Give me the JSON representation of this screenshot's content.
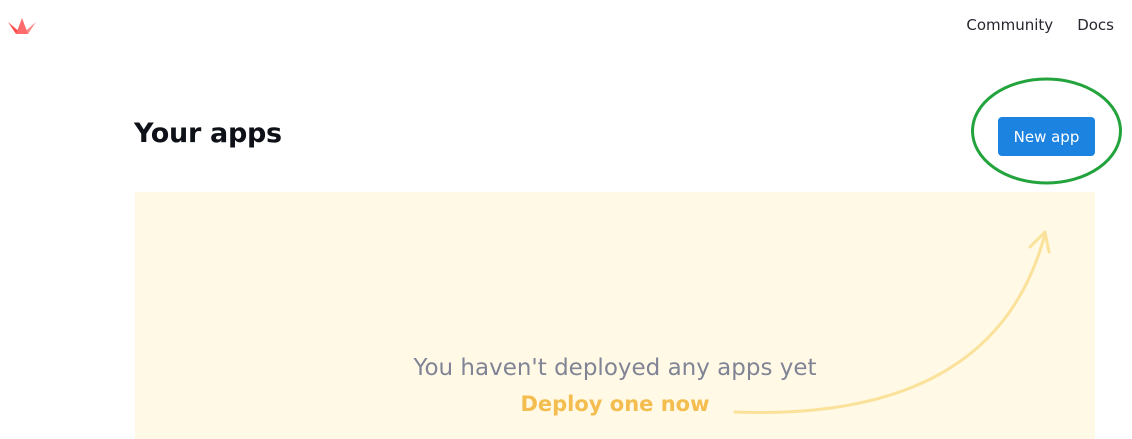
{
  "header": {
    "logo_icon": "streamlit-crown-icon",
    "nav": {
      "community_label": "Community",
      "docs_label": "Docs"
    }
  },
  "main": {
    "title": "Your apps",
    "new_app_label": "New app",
    "empty_state": {
      "message": "You haven't deployed any apps yet",
      "cta_label": "Deploy one now",
      "arrow_icon": "curved-arrow-icon"
    }
  },
  "colors": {
    "primary_button": "#1c83e1",
    "panel_background": "#fff9e6",
    "cta_text": "#f4bd4f",
    "arrow": "#fbe29b",
    "annotation_circle": "#22a33c",
    "logo": "#ff4b4b"
  }
}
